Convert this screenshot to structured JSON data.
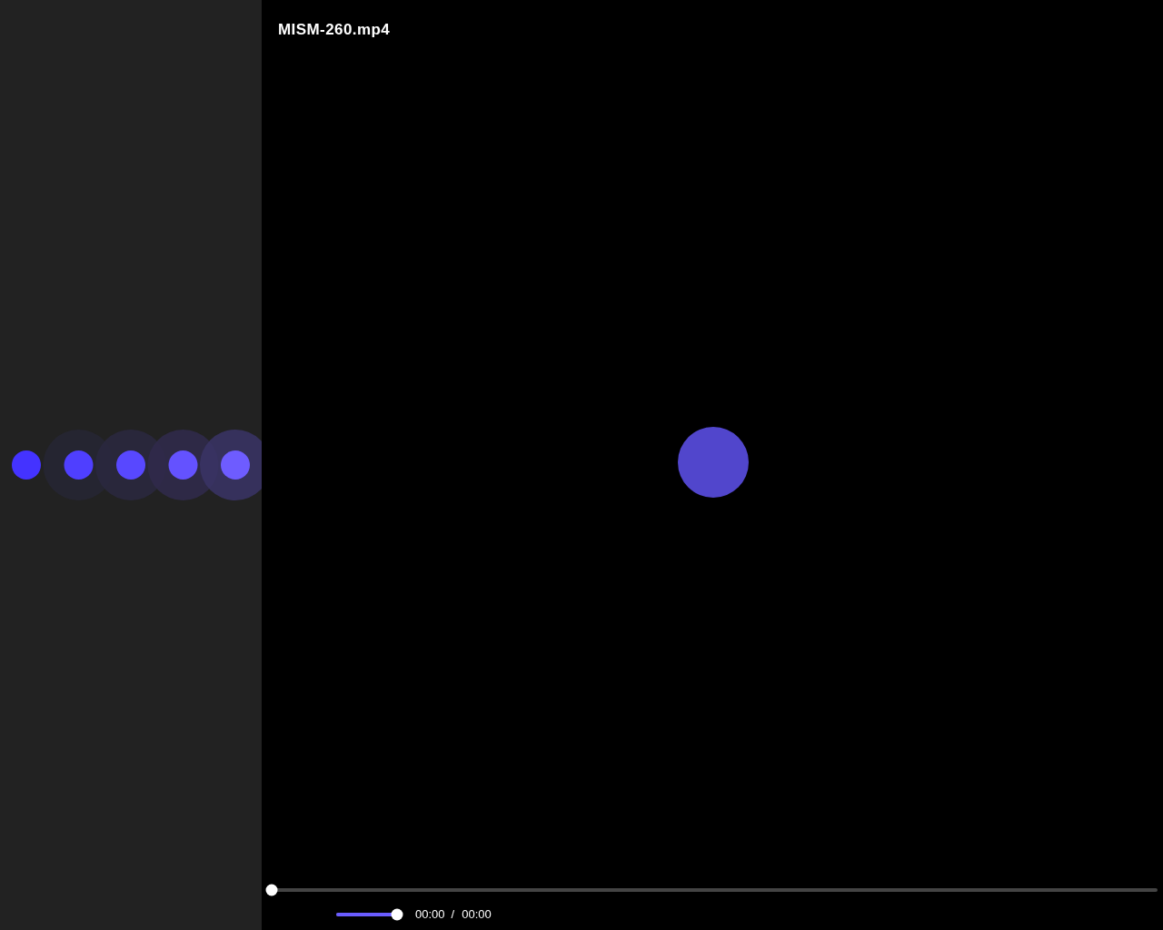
{
  "video": {
    "title": "MISM-260.mp4"
  },
  "seek": {
    "level": 0
  },
  "volume": {
    "level": 1
  },
  "time": {
    "current": "00:00",
    "separator": "/",
    "duration": "00:00"
  }
}
